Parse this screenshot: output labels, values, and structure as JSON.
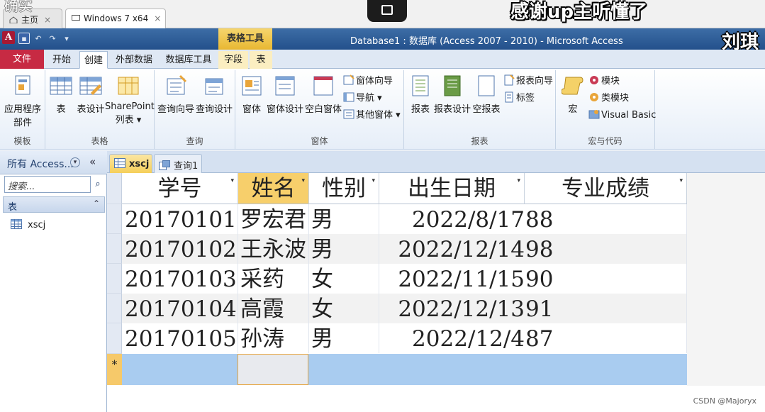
{
  "browser": {
    "tab_home": "主页",
    "tab_vm": "Windows 7 x64"
  },
  "overlay": {
    "top_text": "感谢up主听懂了",
    "side_text": "刘琪",
    "corner_text": "确实"
  },
  "window": {
    "app_icon": "A",
    "context_tab": "表格工具",
    "title": "Database1 : 数据库 (Access 2007 - 2010) - Microsoft Access"
  },
  "ribbon_tabs": [
    {
      "label": "文件"
    },
    {
      "label": "开始"
    },
    {
      "label": "创建"
    },
    {
      "label": "外部数据"
    },
    {
      "label": "数据库工具"
    },
    {
      "label": "字段"
    },
    {
      "label": "表"
    }
  ],
  "ribbon": {
    "templates": {
      "label": "模板",
      "app_parts": "应用程序",
      "app_parts2": "部件"
    },
    "tables": {
      "label": "表格",
      "table": "表",
      "table_design": "表设计",
      "sharepoint": "SharePoint",
      "sharepoint2": "列表"
    },
    "queries": {
      "label": "查询",
      "wizard": "查询向导",
      "design": "查询设计"
    },
    "forms": {
      "label": "窗体",
      "form": "窗体",
      "form_design": "窗体设计",
      "blank_form": "空白窗体",
      "form_wizard": "窗体向导",
      "navigation": "导航",
      "more_forms": "其他窗体"
    },
    "reports": {
      "label": "报表",
      "report": "报表",
      "report_design": "报表设计",
      "blank_report": "空报表",
      "report_wizard": "报表向导",
      "labels": "标签"
    },
    "macros": {
      "label": "宏与代码",
      "macro": "宏",
      "module": "模块",
      "class_module": "类模块",
      "visual_basic": "Visual Basic"
    }
  },
  "nav": {
    "title": "所有 Access...",
    "search_placeholder": "搜索...",
    "section": "表",
    "items": [
      {
        "label": "xscj"
      }
    ]
  },
  "doc_tabs": [
    {
      "label": "xscj"
    },
    {
      "label": "查询1"
    }
  ],
  "table": {
    "columns": [
      "学号",
      "姓名",
      "性别",
      "出生日期",
      "专业成绩"
    ],
    "rows": [
      [
        "20170101",
        "罗宏君",
        "男",
        "2022/8/17",
        "88"
      ],
      [
        "20170102",
        "王永波",
        "男",
        "2022/12/14",
        "98"
      ],
      [
        "20170103",
        "采药",
        "女",
        "2022/11/15",
        "90"
      ],
      [
        "20170104",
        "高霞",
        "女",
        "2022/12/13",
        "91"
      ],
      [
        "20170105",
        "孙涛",
        "男",
        "2022/12/4",
        "87"
      ]
    ],
    "new_row_marker": "*"
  },
  "watermark": "CSDN @Majoryx"
}
